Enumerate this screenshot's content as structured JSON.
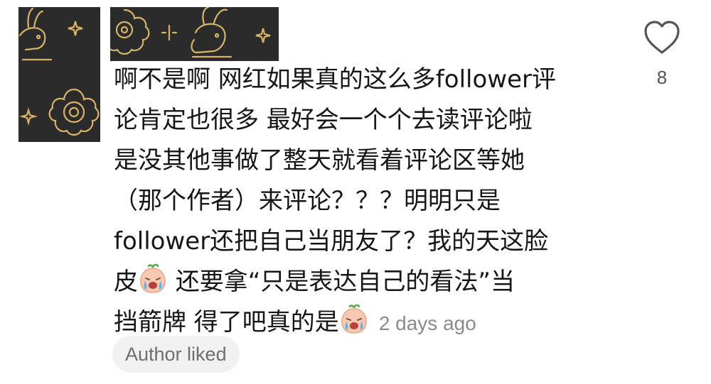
{
  "comment": {
    "lines": [
      "啊不是啊 网红如果真的这么多follower评",
      "论肯定也很多 最好会一个个去读评论啦",
      "是没其他事做了整天就看着评论区等她",
      "（那个作者）来评论？？？明明只是",
      "follower还把自己当朋友了？我的天这脸"
    ],
    "line6_before": "皮",
    "line6_after": " 还要拿“只是表达自己的看法”当",
    "line7_before": "挡箭牌 得了吧真的是",
    "emoji_name": "loudly-crying-peach-emoji",
    "timestamp": "2 days ago"
  },
  "like": {
    "icon": "heart-outline-icon",
    "count": "8"
  },
  "badge": {
    "label": "Author liked"
  },
  "colors": {
    "text": "#161616",
    "muted": "#8a8a8a",
    "avatar_bg": "#2b2b2b",
    "gold": "#d8b46a"
  }
}
